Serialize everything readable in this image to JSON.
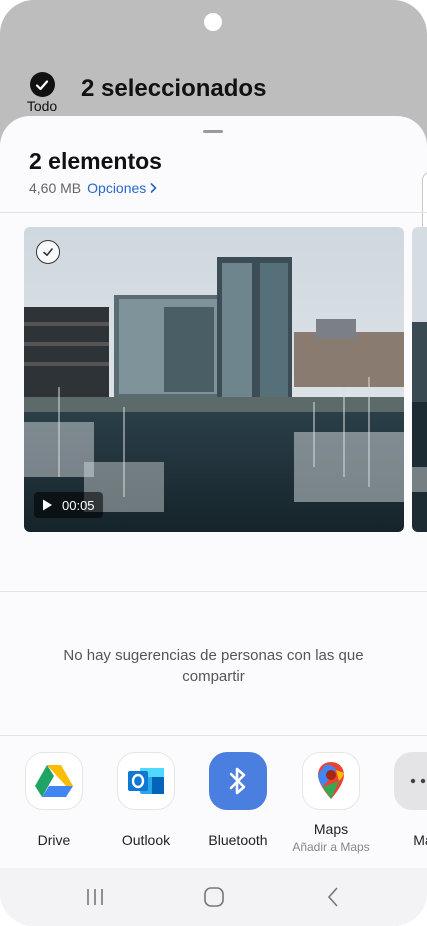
{
  "header": {
    "select_all_label": "Todo",
    "selected_count": "2 seleccionados"
  },
  "sheet": {
    "title": "2 elementos",
    "size": "4,60 MB",
    "options_label": "Opciones"
  },
  "preview": {
    "duration": "00:05"
  },
  "suggestions": {
    "empty_text": "No hay sugerencias de personas con las que compartir"
  },
  "apps": [
    {
      "label": "Drive",
      "sublabel": "",
      "icon": "google-drive-icon"
    },
    {
      "label": "Outlook",
      "sublabel": "",
      "icon": "outlook-icon"
    },
    {
      "label": "Bluetooth",
      "sublabel": "",
      "icon": "bluetooth-icon"
    },
    {
      "label": "Maps",
      "sublabel": "Añadir a Maps",
      "icon": "google-maps-icon"
    },
    {
      "label": "Ma",
      "sublabel": "",
      "icon": "more-icon"
    }
  ],
  "navbar": {
    "recents_icon": "recents-icon",
    "home_icon": "home-icon",
    "back_icon": "back-icon"
  },
  "colors": {
    "link": "#2867c8",
    "bluetooth": "#4a7fe0"
  }
}
